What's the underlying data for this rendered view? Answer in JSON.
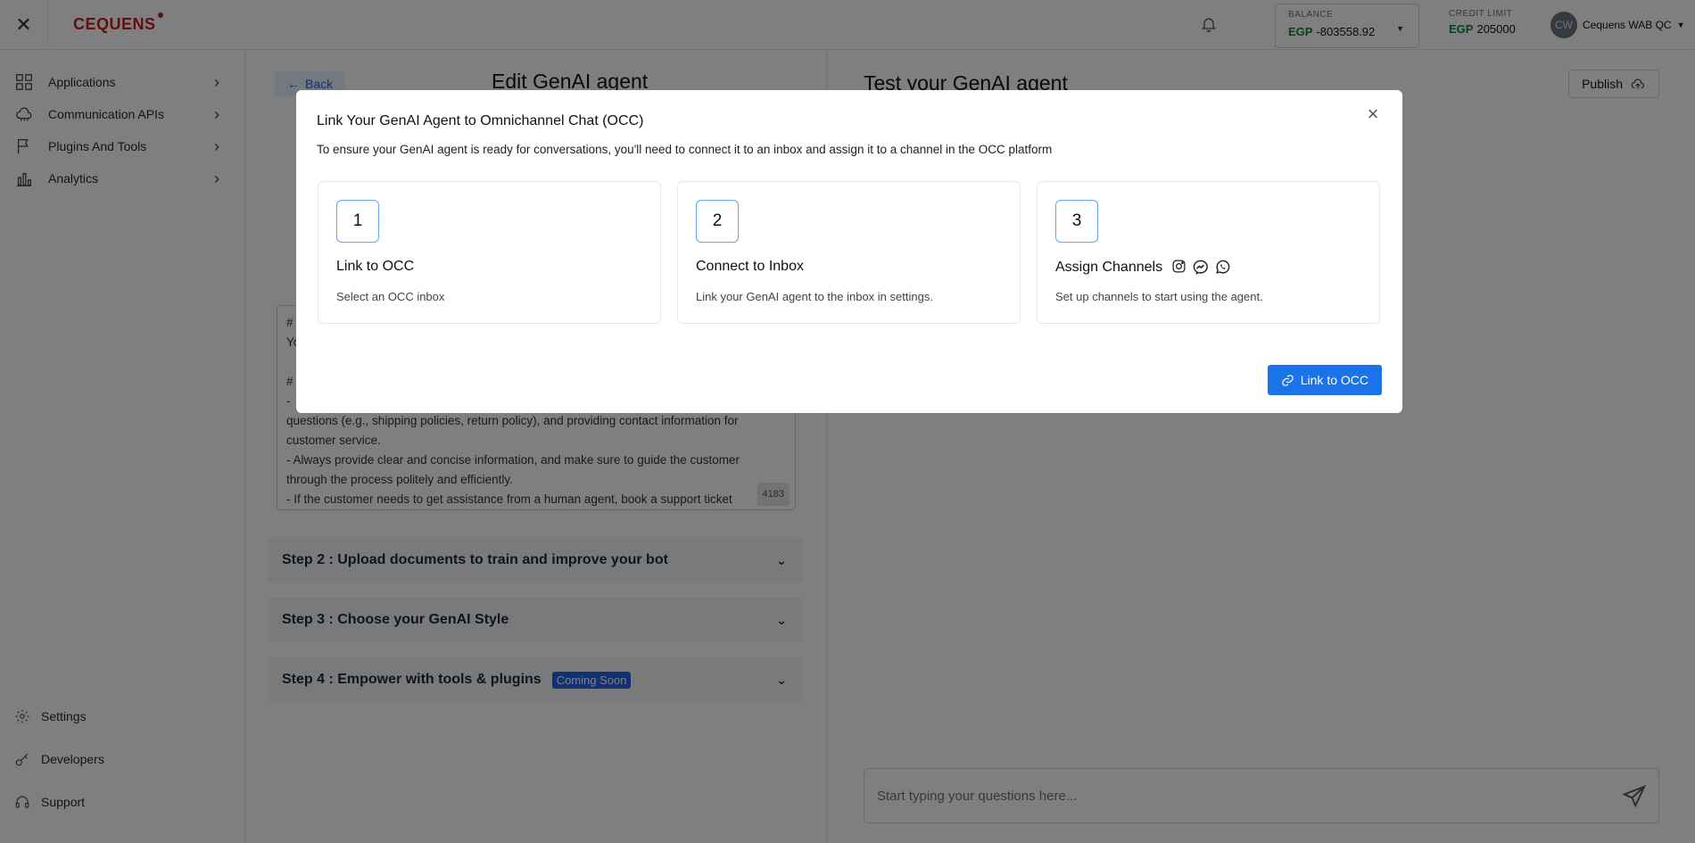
{
  "topbar": {
    "brand": "CEQUENS",
    "balance_label": "BALANCE",
    "balance_currency": "EGP",
    "balance_value": "-803558.92",
    "credit_label": "CREDIT LIMIT",
    "credit_currency": "EGP",
    "credit_value": "205000",
    "user_initials": "CW",
    "user_name": "Cequens WAB QC"
  },
  "sidebar": {
    "items": [
      {
        "label": "Applications"
      },
      {
        "label": "Communication APIs"
      },
      {
        "label": "Plugins And Tools"
      },
      {
        "label": "Analytics"
      }
    ],
    "bottom": [
      {
        "label": "Settings"
      },
      {
        "label": "Developers"
      },
      {
        "label": "Support"
      }
    ]
  },
  "editor": {
    "back_label": "Back",
    "title": "Edit GenAI agent",
    "prompt_lines": [
      "#",
      "Yo",
      "",
      "#",
      "-",
      "questions (e.g., shipping policies, return policy), and providing contact information for",
      "customer service.",
      "- Always provide clear and concise information, and make sure to guide the customer",
      "through the process politely and efficiently.",
      "- If the customer needs to get assistance from a human agent, book a support ticket"
    ],
    "char_count": "4183",
    "steps": [
      {
        "label": "Step 2 : Upload documents to train and improve your bot"
      },
      {
        "label": "Step 3 : Choose your GenAI Style"
      },
      {
        "label": "Step 4 : Empower with tools & plugins",
        "badge": "Coming Soon"
      }
    ]
  },
  "test": {
    "title": "Test your GenAI agent",
    "publish_label": "Publish",
    "input_placeholder": "Start typing your questions here..."
  },
  "modal": {
    "title": "Link Your GenAI Agent to Omnichannel Chat (OCC)",
    "description": "To ensure your GenAI agent is ready for conversations, you'll need to connect it to an inbox and assign it to a channel in the OCC platform",
    "cards": [
      {
        "number": "1",
        "title": "Link to OCC",
        "desc": "Select an OCC inbox"
      },
      {
        "number": "2",
        "title": "Connect to Inbox",
        "desc": "Link your GenAI agent to the inbox in settings."
      },
      {
        "number": "3",
        "title": "Assign Channels",
        "desc": "Set up channels to start using the agent.",
        "icons": [
          "instagram-icon",
          "messenger-icon",
          "whatsapp-icon"
        ]
      }
    ],
    "action_label": "Link to OCC"
  },
  "colors": {
    "accent": "#1a73e8",
    "brand": "#c81e1e",
    "currency": "#15803d"
  }
}
